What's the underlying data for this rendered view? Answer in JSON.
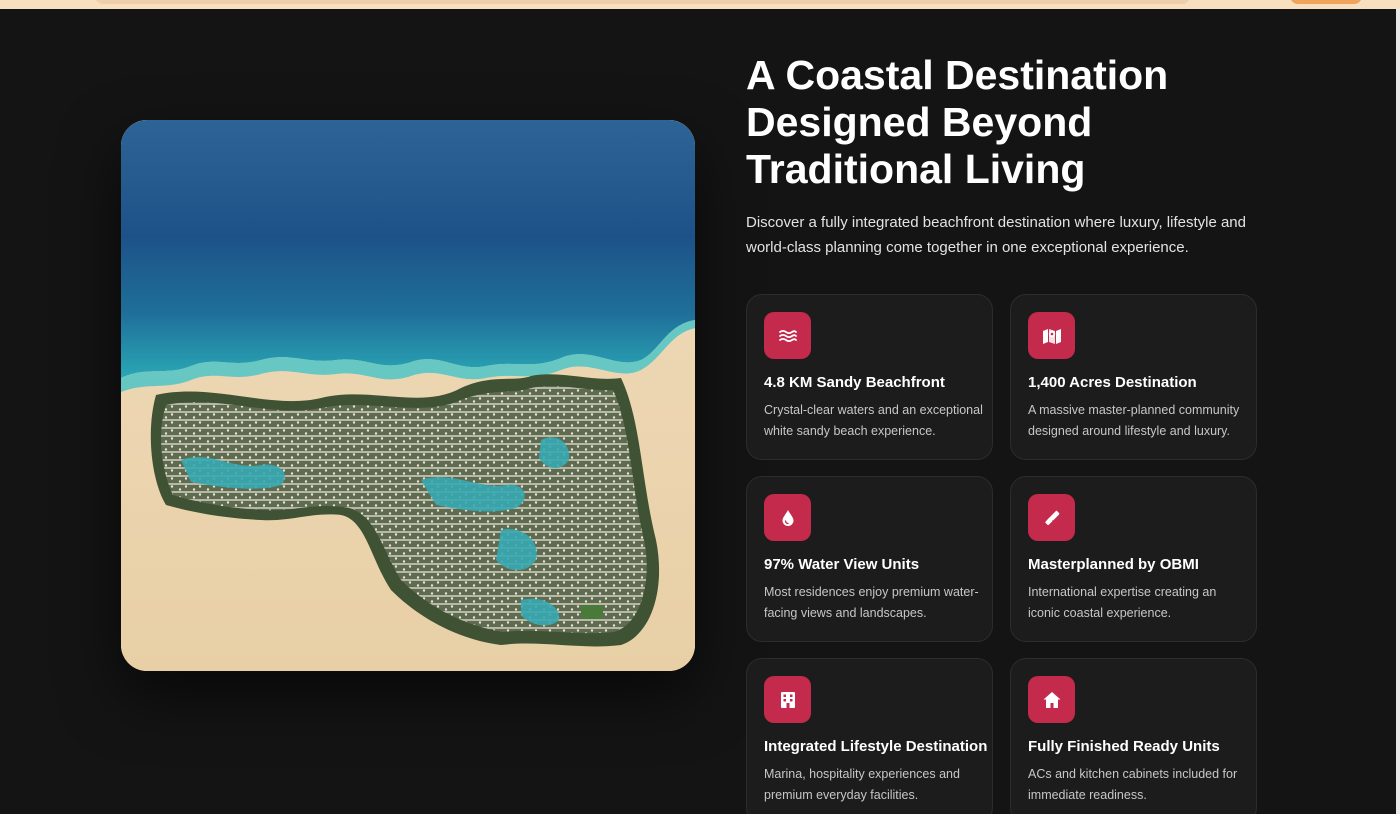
{
  "section": {
    "title": "A Coastal Destination Designed Beyond Traditional Living",
    "intro": "Discover a fully integrated beachfront destination where luxury, lifestyle and world-class planning come together in one exceptional experience."
  },
  "features": [
    {
      "icon": "water-waves-icon",
      "title": "4.8 KM Sandy Beachfront",
      "desc": "Crystal-clear waters and an exceptional white sandy beach experience."
    },
    {
      "icon": "map-icon",
      "title": "1,400 Acres Destination",
      "desc": "A massive master-planned community designed around lifestyle and luxury."
    },
    {
      "icon": "water-drop-icon",
      "title": "97% Water View Units",
      "desc": "Most residences enjoy premium water-facing views and landscapes."
    },
    {
      "icon": "pencil-ruler-icon",
      "title": "Masterplanned by OBMI",
      "desc": "International expertise creating an iconic coastal experience."
    },
    {
      "icon": "building-icon",
      "title": "Integrated Lifestyle Destination",
      "desc": "Marina, hospitality experiences and premium everyday facilities."
    },
    {
      "icon": "house-icon",
      "title": "Fully Finished Ready Units",
      "desc": "ACs and kitchen cabinets included for immediate readiness."
    }
  ],
  "colors": {
    "accent": "#c42a4c",
    "background": "#141414",
    "card": "#1c1c1c"
  }
}
